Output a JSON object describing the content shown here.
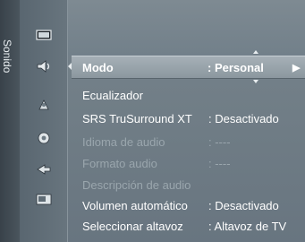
{
  "sidebar": {
    "title": "Sonido"
  },
  "icons": [
    "picture-icon",
    "sound-icon",
    "channel-icon",
    "setup-icon",
    "input-icon",
    "application-icon"
  ],
  "selected": {
    "label": "Modo",
    "value": ": Personal",
    "arrow": "▶"
  },
  "items": [
    {
      "label": "Ecualizador",
      "value": ""
    },
    {
      "label": "SRS TruSurround XT",
      "value": ": Desactivado"
    },
    {
      "label": "Idioma de audio",
      "value": ": ----"
    },
    {
      "label": "Formato audio",
      "value": ": ----"
    },
    {
      "label": "Descripción de audio",
      "value": ""
    },
    {
      "label": "Volumen automático",
      "value": ": Desactivado"
    },
    {
      "label": "Seleccionar altavoz",
      "value": ": Altavoz de TV"
    }
  ]
}
